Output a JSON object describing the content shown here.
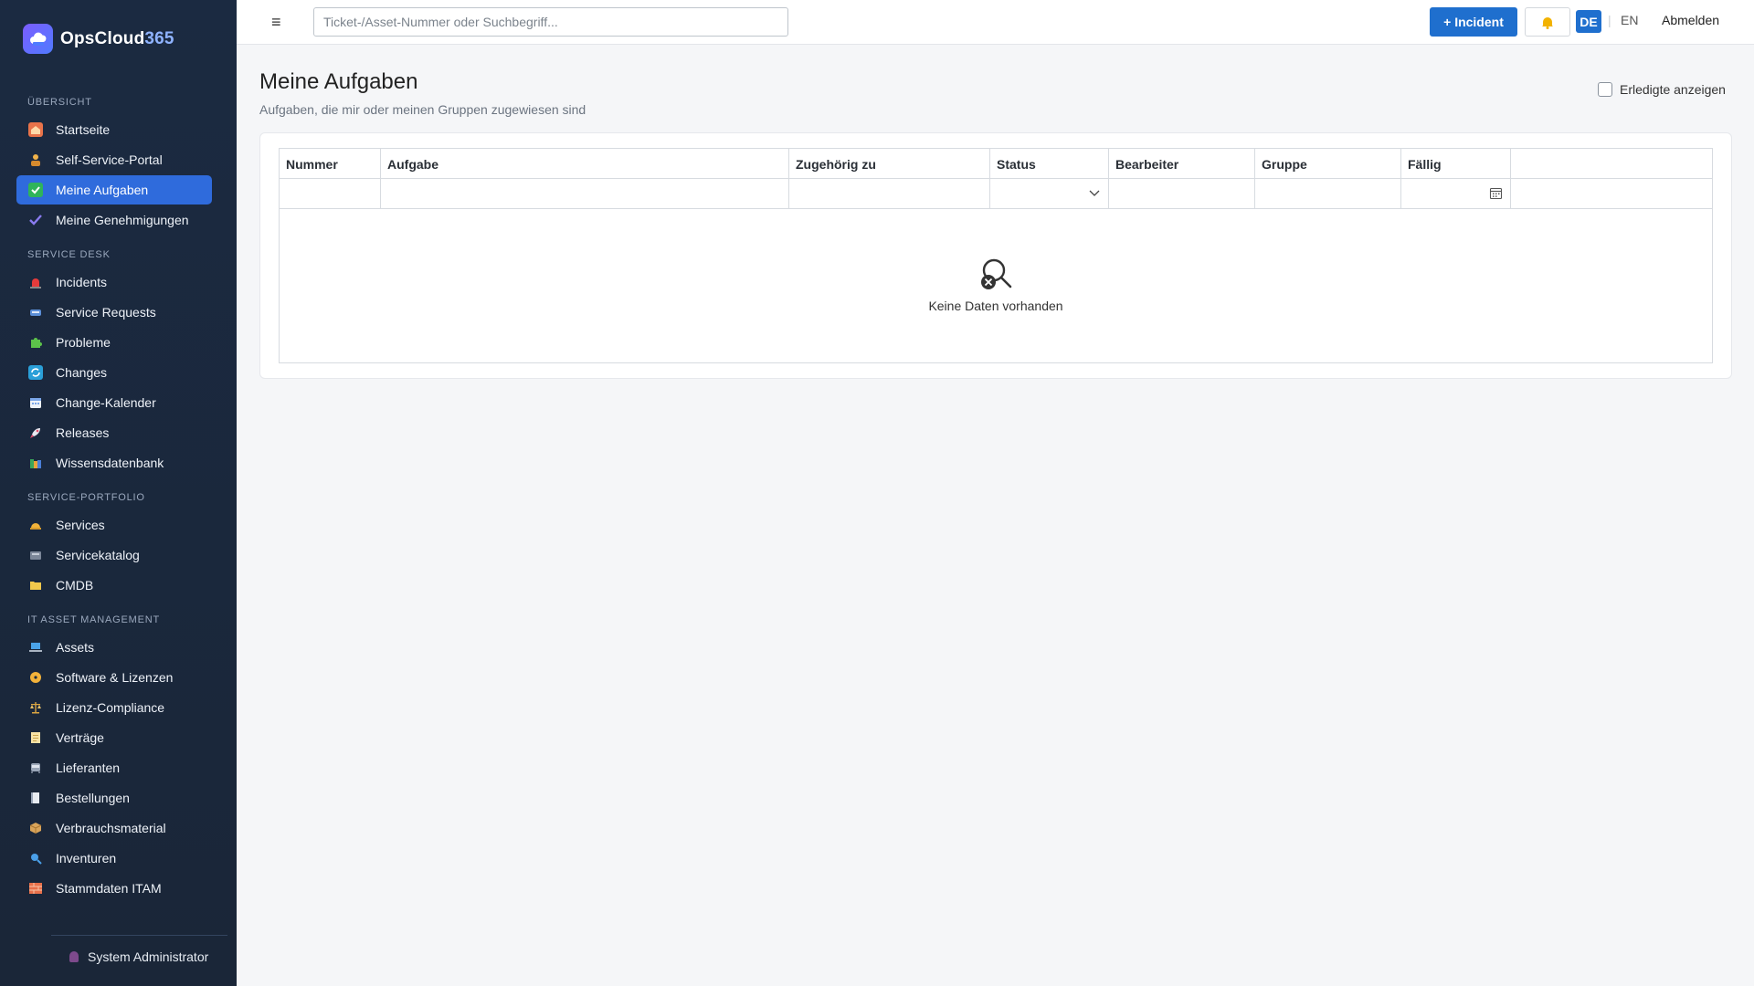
{
  "brand": {
    "name_part1": "OpsCloud",
    "name_part2": "365"
  },
  "topbar": {
    "search_placeholder": "Ticket-/Asset-Nummer oder Suchbegriff...",
    "incident_button": "+ Incident",
    "lang_de": "DE",
    "lang_sep": "|",
    "lang_en": "EN",
    "logout": "Abmelden"
  },
  "sidebar": {
    "sections": [
      {
        "title": "ÜBERSICHT",
        "items": [
          {
            "label": "Startseite",
            "icon": "home-icon",
            "active": false
          },
          {
            "label": "Self-Service-Portal",
            "icon": "person-icon",
            "active": false
          },
          {
            "label": "Meine Aufgaben",
            "icon": "check-box-icon",
            "active": true
          },
          {
            "label": "Meine Genehmigungen",
            "icon": "check-mark-icon",
            "active": false
          }
        ]
      },
      {
        "title": "SERVICE DESK",
        "items": [
          {
            "label": "Incidents",
            "icon": "siren-icon",
            "active": false
          },
          {
            "label": "Service Requests",
            "icon": "mailbox-icon",
            "active": false
          },
          {
            "label": "Probleme",
            "icon": "puzzle-icon",
            "active": false
          },
          {
            "label": "Changes",
            "icon": "cycle-icon",
            "active": false
          },
          {
            "label": "Change-Kalender",
            "icon": "calendar-icon",
            "active": false
          },
          {
            "label": "Releases",
            "icon": "rocket-icon",
            "active": false
          },
          {
            "label": "Wissensdatenbank",
            "icon": "books-icon",
            "active": false
          }
        ]
      },
      {
        "title": "SERVICE-PORTFOLIO",
        "items": [
          {
            "label": "Services",
            "icon": "bell-service-icon",
            "active": false
          },
          {
            "label": "Servicekatalog",
            "icon": "catalog-icon",
            "active": false
          },
          {
            "label": "CMDB",
            "icon": "folder-icon",
            "active": false
          }
        ]
      },
      {
        "title": "IT ASSET MANAGEMENT",
        "items": [
          {
            "label": "Assets",
            "icon": "laptop-icon",
            "active": false
          },
          {
            "label": "Software & Lizenzen",
            "icon": "disc-icon",
            "active": false
          },
          {
            "label": "Lizenz-Compliance",
            "icon": "scales-icon",
            "active": false
          },
          {
            "label": "Verträge",
            "icon": "document-icon",
            "active": false
          },
          {
            "label": "Lieferanten",
            "icon": "truck-icon",
            "active": false
          },
          {
            "label": "Bestellungen",
            "icon": "receipt-icon",
            "active": false
          },
          {
            "label": "Verbrauchsmaterial",
            "icon": "package-icon",
            "active": false
          },
          {
            "label": "Inventuren",
            "icon": "magnifier-icon",
            "active": false
          },
          {
            "label": "Stammdaten ITAM",
            "icon": "bricks-icon",
            "active": false
          }
        ]
      }
    ],
    "user": "System Administrator"
  },
  "main": {
    "title": "Meine Aufgaben",
    "subtitle": "Aufgaben, die mir oder meinen Gruppen zugewiesen sind",
    "show_done_label": "Erledigte anzeigen",
    "show_done_checked": false,
    "table": {
      "columns": [
        "Nummer",
        "Aufgabe",
        "Zugehörig zu",
        "Status",
        "Bearbeiter",
        "Gruppe",
        "Fällig",
        ""
      ],
      "empty_text": "Keine Daten vorhanden"
    }
  },
  "colors": {
    "sidebar_bg": "#1b2a41",
    "accent": "#1f6fce",
    "active_nav": "#2f6bdc"
  }
}
